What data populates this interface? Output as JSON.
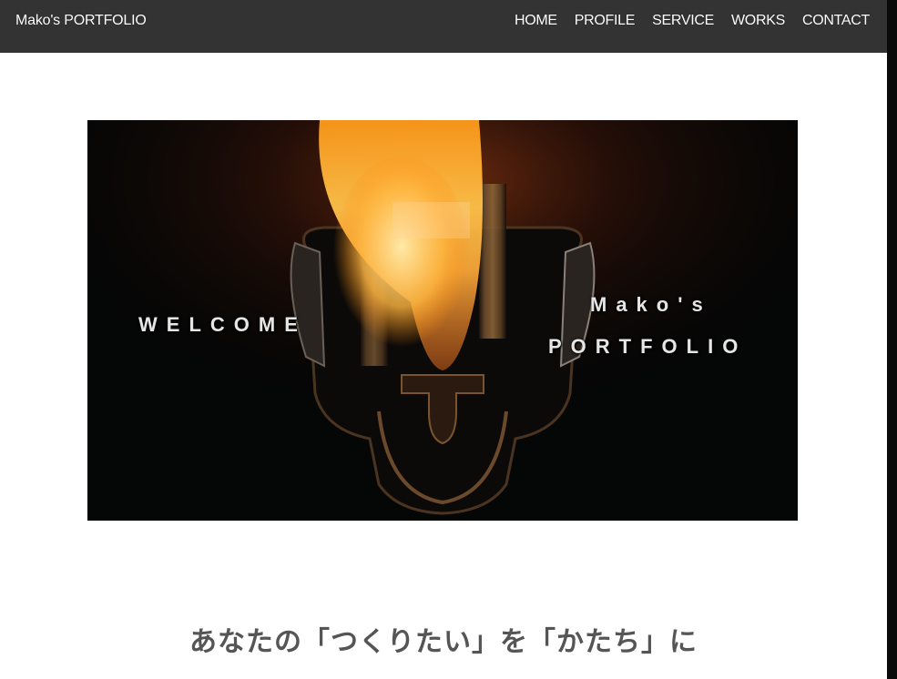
{
  "header": {
    "brand": "Mako's PORTFOLIO",
    "nav": [
      "HOME",
      "PROFILE",
      "SERVICE",
      "WORKS",
      "CONTACT"
    ]
  },
  "hero": {
    "left_text": "WELCOME",
    "right_line1": "Mako's",
    "right_line2": "PORTFOLIO",
    "image": "lighter-flame-photo"
  },
  "tagline": "あなたの「つくりたい」を「かたち」に",
  "colors": {
    "header_bg": "#333333",
    "page_bg": "#ffffff",
    "tagline": "#555555",
    "hero_bg": "#050606"
  }
}
